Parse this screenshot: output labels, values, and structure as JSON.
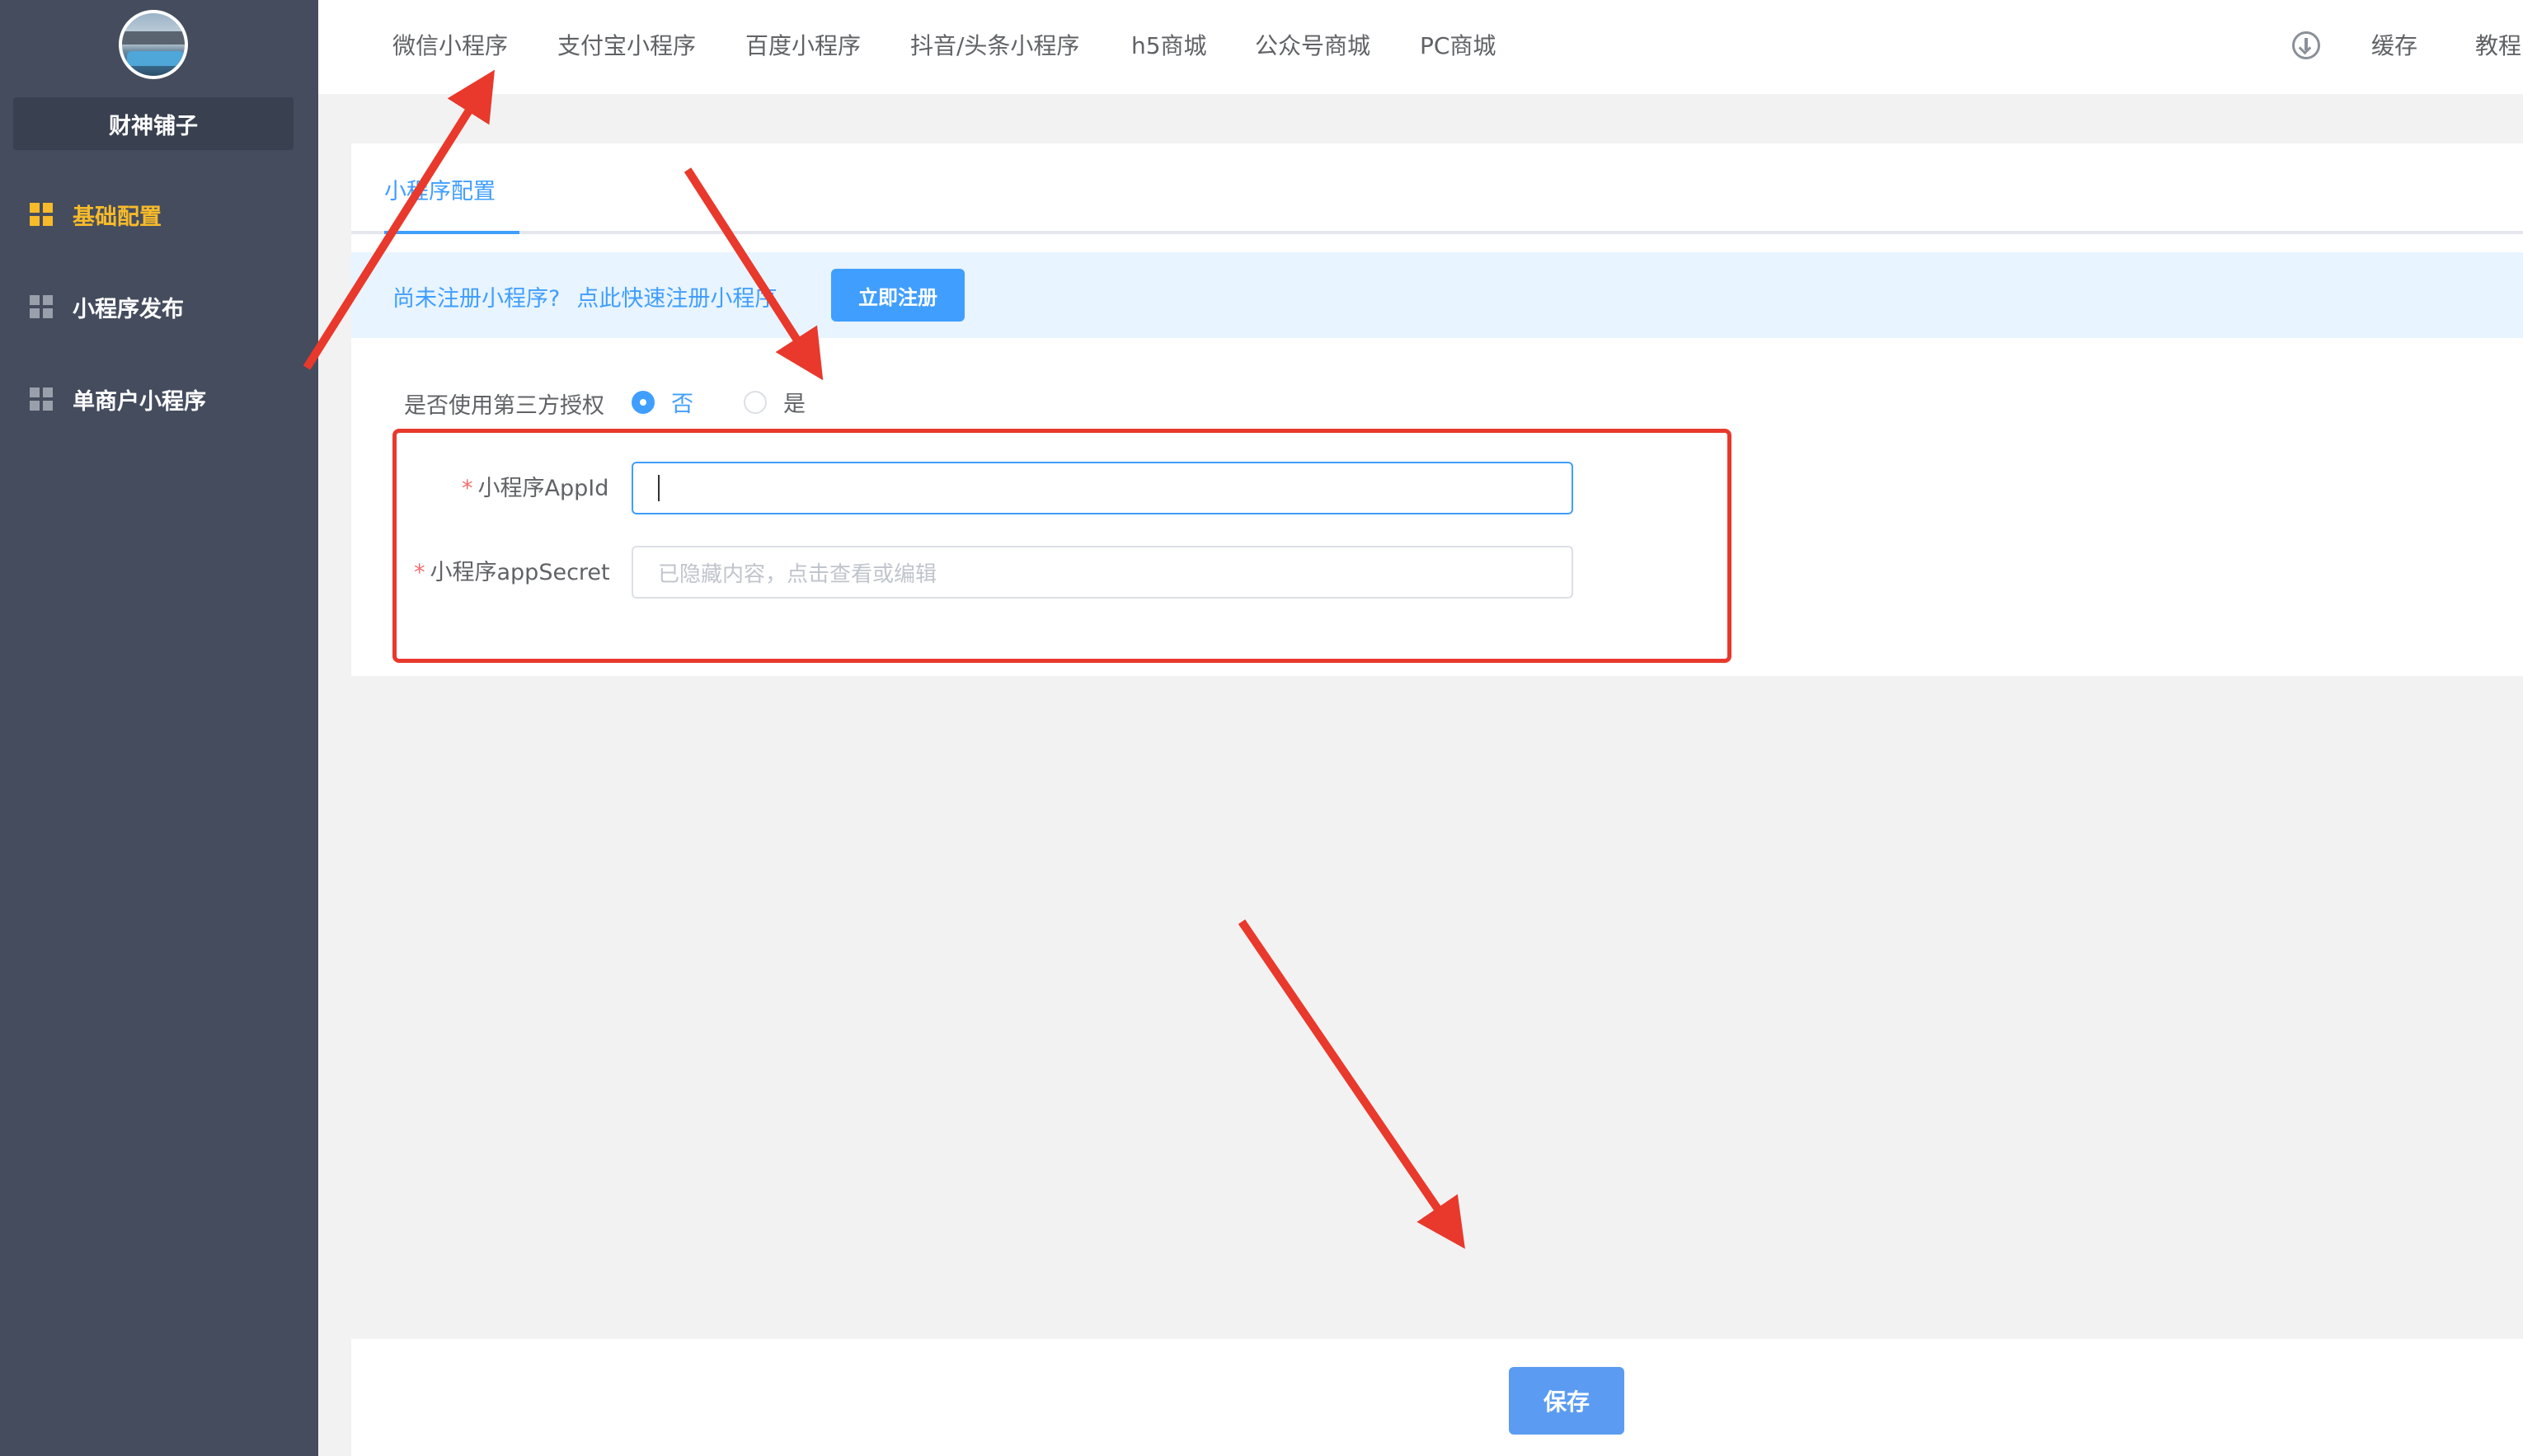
{
  "sidebar": {
    "shop_name": "财神铺子",
    "items": [
      {
        "label": "基础配置",
        "active": true
      },
      {
        "label": "小程序发布",
        "active": false
      },
      {
        "label": "单商户小程序",
        "active": false
      }
    ]
  },
  "topnav": {
    "tabs": [
      "微信小程序",
      "支付宝小程序",
      "百度小程序",
      "抖音/头条小程序",
      "h5商城",
      "公众号商城",
      "PC商城"
    ],
    "cache_label": "缓存",
    "tutorial_label": "教程"
  },
  "config": {
    "tab_label": "小程序配置",
    "notice_text": "尚未注册小程序?",
    "notice_link": "点此快速注册小程序",
    "register_button": "立即注册",
    "third_party": {
      "label": "是否使用第三方授权",
      "options": [
        "否",
        "是"
      ],
      "selected": "否"
    },
    "appid": {
      "label": "小程序AppId",
      "value": ""
    },
    "appsecret": {
      "label": "小程序appSecret",
      "placeholder": "已隐藏内容，点击查看或编辑"
    },
    "required_mark": "*"
  },
  "footer": {
    "save_button": "保存"
  },
  "colors": {
    "primary": "#409eff",
    "sidebar_bg": "#444c5e",
    "active_nav": "#f7ba2a",
    "annotation_red": "#e8392c"
  }
}
